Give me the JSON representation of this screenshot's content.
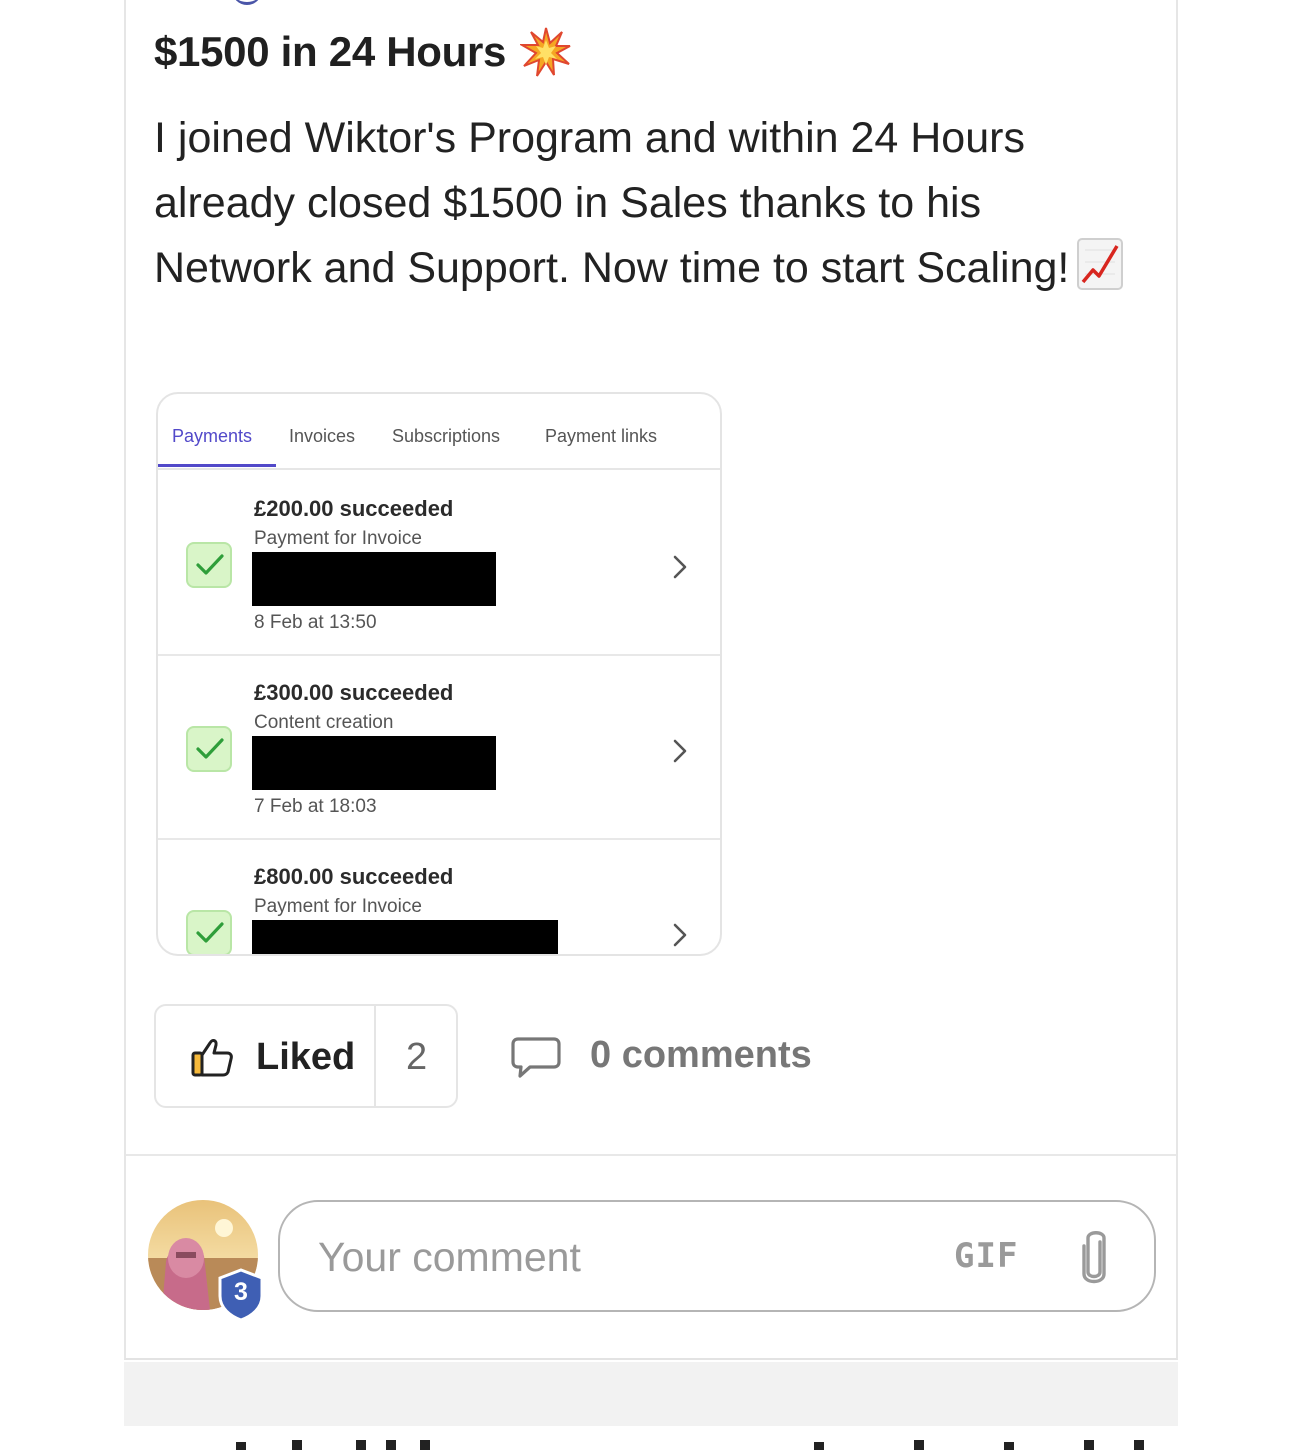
{
  "post": {
    "title": "$1500 in 24 Hours",
    "title_emoji": "collision-icon",
    "body_lines": [
      "I joined Wiktor's Program and within 24 Hours",
      "already closed $1500 in Sales thanks to his",
      "Network and Support. Now time to start Scaling!"
    ],
    "body_emoji": "chart-increasing-icon"
  },
  "screenshot": {
    "tabs": [
      {
        "label": "Payments",
        "active": true
      },
      {
        "label": "Invoices",
        "active": false
      },
      {
        "label": "Subscriptions",
        "active": false
      },
      {
        "label": "Payment links",
        "active": false
      }
    ],
    "payments": [
      {
        "amount": "£200.00 succeeded",
        "description": "Payment for Invoice",
        "date": "8 Feb at 13:50"
      },
      {
        "amount": "£300.00 succeeded",
        "description": "Content creation",
        "date": "7 Feb at 18:03"
      },
      {
        "amount": "£800.00 succeeded",
        "description": "Payment for Invoice",
        "date": ""
      }
    ],
    "accent_color": "#5249c9",
    "success_color": "#d9f5c8"
  },
  "actions": {
    "like_label": "Liked",
    "like_count": "2",
    "comments_label": "0 comments"
  },
  "comment_box": {
    "placeholder": "Your comment",
    "gif_label": "GIF",
    "avatar_level": "3"
  }
}
